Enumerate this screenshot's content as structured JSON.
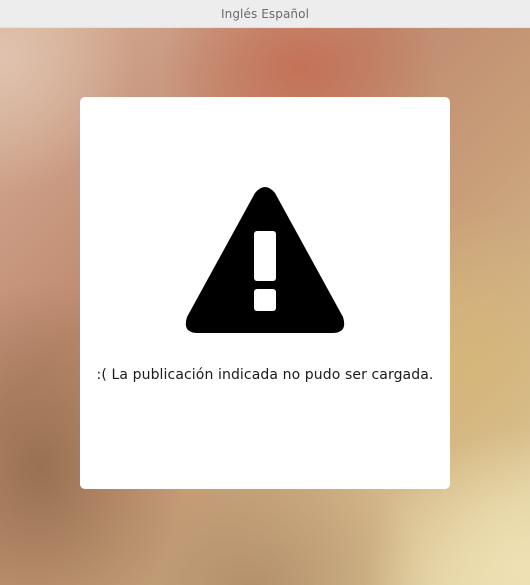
{
  "header": {
    "title": "Inglés Español"
  },
  "error": {
    "icon": "warning-triangle-icon",
    "message": ":( La publicación indicada no pudo ser cargada."
  },
  "colors": {
    "header_bg": "#ededed",
    "header_text": "#6b6b6b",
    "card_bg": "#ffffff",
    "icon_color": "#000000",
    "text_color": "#1a1a1a"
  }
}
